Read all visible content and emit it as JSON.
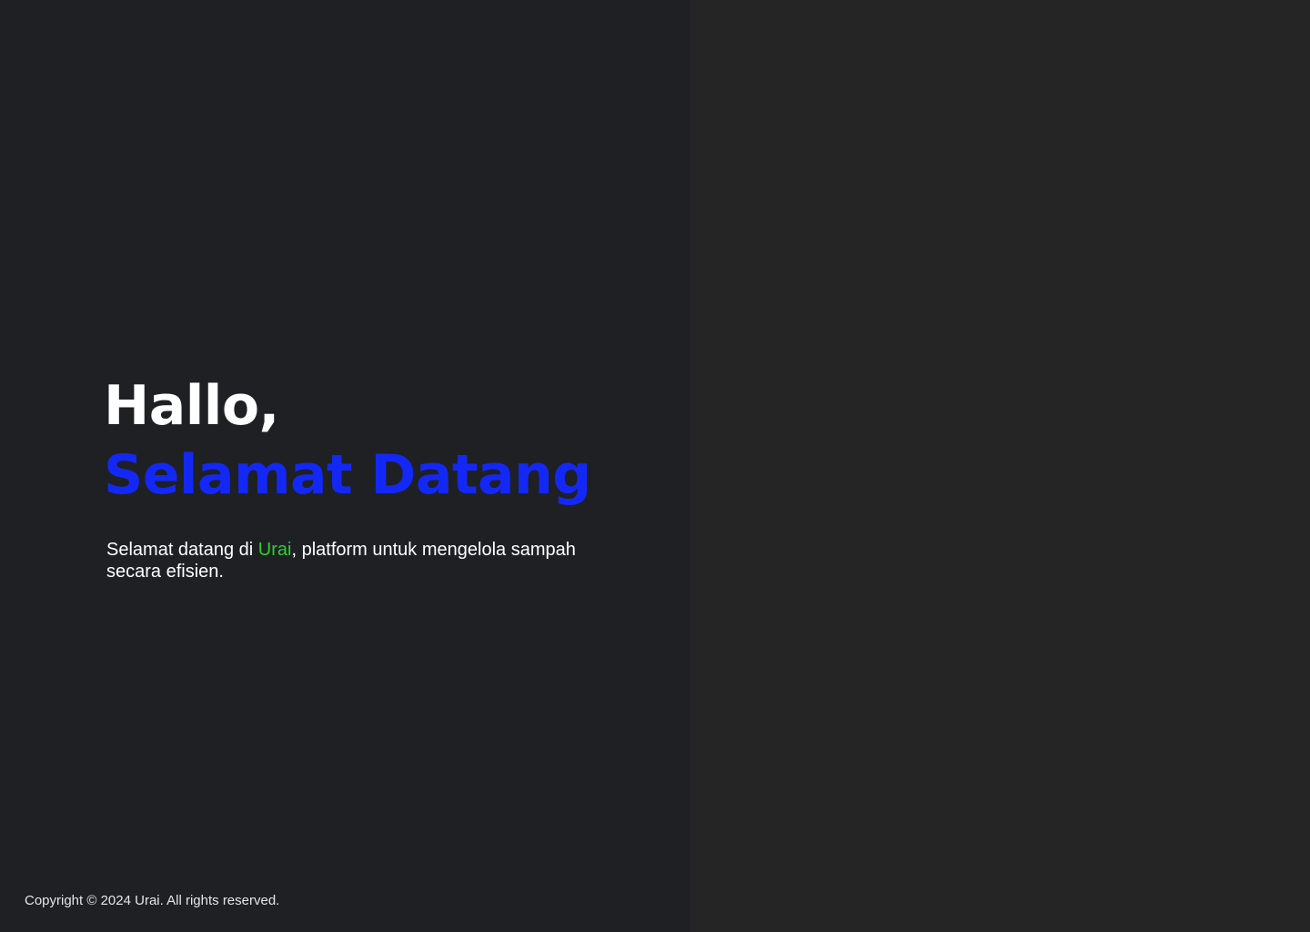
{
  "welcome": {
    "greeting": "Hallo,",
    "headline": "Selamat Datang",
    "intro_before": "Selamat datang di ",
    "intro_brand": "Urai",
    "intro_after": ", platform untuk mengelola sampah secara efisien."
  },
  "footer": {
    "copyright": "Copyright © 2024 Urai. All rights reserved."
  },
  "colors": {
    "left_background": "#1f2024",
    "right_background": "#252525",
    "headline_accent": "#1428f5",
    "brand_accent": "#2bd12b",
    "text": "#ffffff"
  }
}
